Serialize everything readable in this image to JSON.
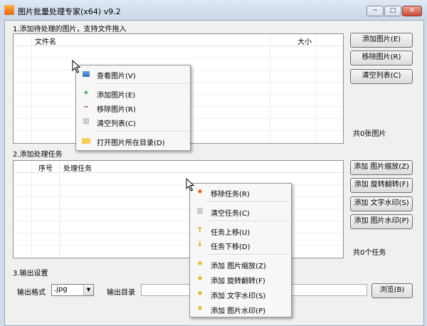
{
  "window": {
    "title": "图片批量处理专家(x64) v9.2",
    "min": "─",
    "max": "□",
    "close": "✕"
  },
  "section1": {
    "title": "1.添加待处理的图片，支持文件拖入",
    "columns": {
      "filename": "文件名",
      "size": "大小"
    },
    "buttons": {
      "add": "添加图片(E)",
      "remove": "移除图片(R)",
      "clear": "清空列表(C)"
    },
    "count": "共0张图片"
  },
  "section2": {
    "title": "2.添加处理任务",
    "columns": {
      "seq": "序号",
      "task": "处理任务"
    },
    "buttons": {
      "scale": "添加 图片缩放(Z)",
      "rotate": "添加 旋转翻转(F)",
      "text_wm": "添加 文字水印(S)",
      "img_wm": "添加 图片水印(P)"
    },
    "count": "共0个任务"
  },
  "section3": {
    "title": "3.输出设置",
    "format_label": "输出格式",
    "format_value": ".jpg",
    "dir_label": "输出目录",
    "dir_value": "",
    "browse": "浏览(B)"
  },
  "menu1": {
    "items": [
      {
        "label": "查看图片(V)",
        "icon": "view-icon"
      },
      {
        "label": "添加图片(E)",
        "icon": "add-image-icon"
      },
      {
        "label": "移除图片(R)",
        "icon": "remove-image-icon"
      },
      {
        "label": "清空列表(C)",
        "icon": "trash-icon"
      },
      {
        "label": "打开图片所在目录(D)",
        "icon": "folder-icon"
      }
    ]
  },
  "menu2": {
    "items": [
      {
        "label": "移除任务(R)",
        "icon": "remove-task-icon"
      },
      {
        "label": "清空任务(C)",
        "icon": "trash-icon"
      },
      {
        "label": "任务上移(U)",
        "icon": "arrow-up-icon"
      },
      {
        "label": "任务下移(D)",
        "icon": "arrow-down-icon"
      },
      {
        "label": "添加 图片缩放(Z)",
        "icon": "star-icon"
      },
      {
        "label": "添加 旋转翻转(F)",
        "icon": "star-icon"
      },
      {
        "label": "添加 文字水印(S)",
        "icon": "star-icon"
      },
      {
        "label": "添加 图片水印(P)",
        "icon": "star-icon"
      }
    ]
  }
}
